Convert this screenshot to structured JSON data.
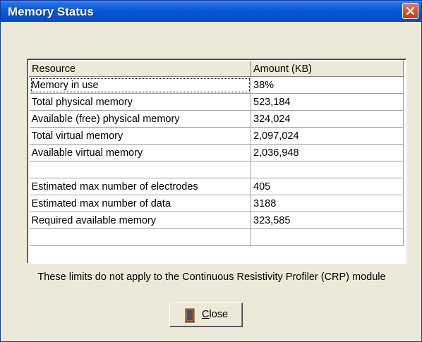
{
  "window": {
    "title": "Memory Status"
  },
  "table": {
    "columns": [
      "Resource",
      "Amount (KB)"
    ],
    "rows": [
      [
        "Memory in use",
        "38%"
      ],
      [
        "Total physical memory",
        "523,184"
      ],
      [
        "Available (free) physical memory",
        "324,024"
      ],
      [
        "Total virtual memory",
        "2,097,024"
      ],
      [
        "Available virtual memory",
        "2,036,948"
      ],
      [
        "",
        ""
      ],
      [
        "Estimated max number of electrodes",
        "405"
      ],
      [
        "Estimated max number of data",
        "3188"
      ],
      [
        "Required available memory",
        "323,585"
      ],
      [
        "",
        ""
      ]
    ]
  },
  "note": "These limits do not apply to the Continuous Resistivity Profiler (CRP) module",
  "close_button": {
    "mnemonic": "C",
    "label_rest": "lose",
    "icon": "door-exit-icon"
  },
  "colors": {
    "titlebar": "#0A58DB",
    "dialog_bg": "#ECE9D8",
    "close_x": "#D7522D"
  }
}
